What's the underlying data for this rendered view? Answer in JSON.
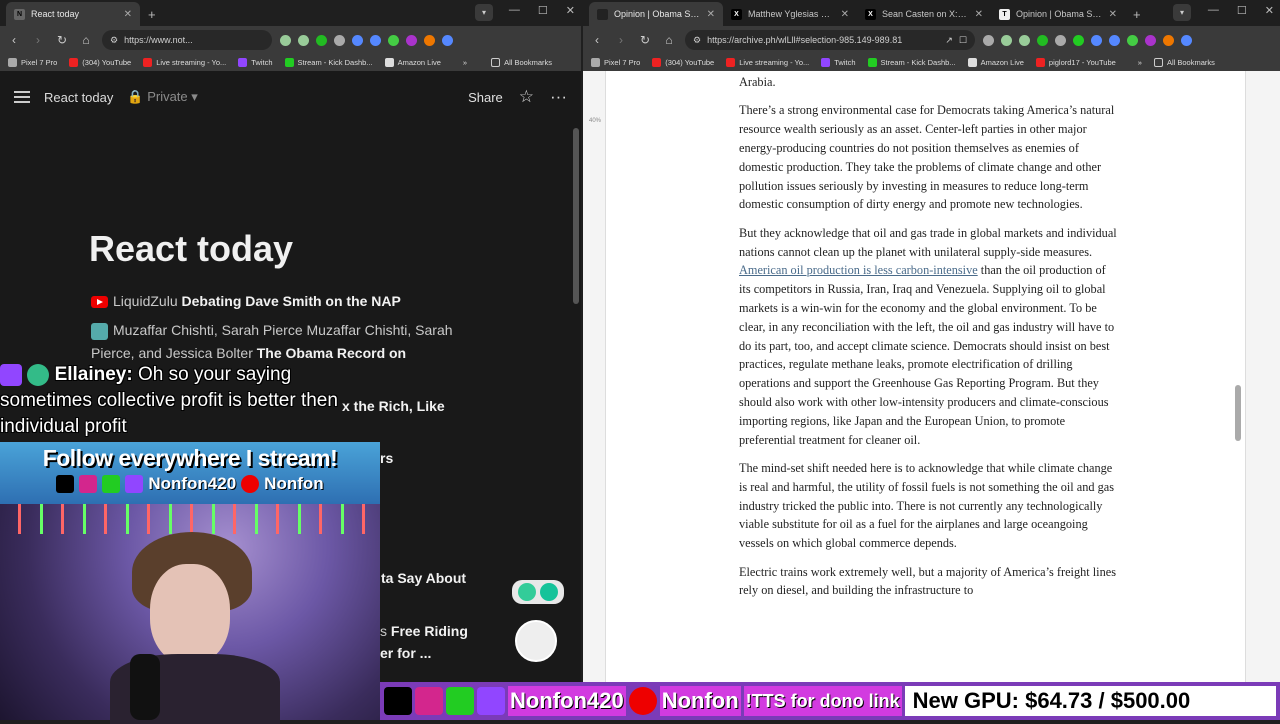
{
  "left_window": {
    "tabs": [
      {
        "label": "React today",
        "active": true
      }
    ],
    "url": "https://www.not...",
    "bookmarks": [
      "Pixel 7 Pro",
      "(304) YouTube",
      "Live streaming - Yo...",
      "Twitch",
      "Stream - Kick Dashb...",
      "Amazon Live"
    ],
    "all_bookmarks": "All Bookmarks",
    "page": {
      "breadcrumb": "React today",
      "privacy": "Private",
      "share": "Share",
      "title": "React today",
      "items": [
        {
          "prefix": "LiquidZulu",
          "title": "Debating Dave Smith on the NAP"
        },
        {
          "prefix": "Muzaffar Chishti, Sarah Pierce Muzaffar Chishti, Sarah Pierce, and Jessica Bolter",
          "title": "The Obama Record on"
        },
        {
          "prefix": "",
          "title": "x the Rich, Like"
        },
        {
          "prefix": "",
          "title": "rs"
        },
        {
          "prefix": "",
          "title": "ta Say About"
        },
        {
          "prefix": "s",
          "title": "Free Riding"
        },
        {
          "prefix": "",
          "title": "er for ..."
        }
      ]
    }
  },
  "stream_overlay": {
    "chat_user": "Ellainey:",
    "chat_message": "Oh so your saying sometimes collective profit is better then individual profit",
    "follow_title": "Follow everywhere I stream!",
    "handle": "Nonfon420",
    "yt_handle": "Nonfon",
    "tts": "!TTS for dono link",
    "gpu": "New GPU: $64.73 / $500.00"
  },
  "right_window": {
    "tabs": [
      {
        "label": "Opinion | Obama Support",
        "active": true
      },
      {
        "label": "Matthew Yglesias on X: \"O",
        "active": false
      },
      {
        "label": "Sean Casten on X: \"This Y",
        "active": false
      },
      {
        "label": "Opinion | Obama Support",
        "active": false
      }
    ],
    "url": "https://archive.ph/wlLll#selection-985.149-989.81",
    "bookmarks": [
      "Pixel 7 Pro",
      "(304) YouTube",
      "Live streaming - Yo...",
      "Twitch",
      "Stream - Kick Dashb...",
      "Amazon Live",
      "piglord17 - YouTube"
    ],
    "all_bookmarks": "All Bookmarks",
    "percent": "40%",
    "article": {
      "p0": "Arabia.",
      "p1": "There’s a strong environmental case for Democrats taking America’s natural resource wealth seriously as an asset. Center-left parties in other major energy-producing countries do not position themselves as enemies of domestic production. They take the problems of climate change and other pollution issues seriously by investing in measures to reduce long-term domestic consumption of dirty energy and promote new technologies.",
      "p2a": "But they acknowledge that oil and gas trade in global markets and individual nations cannot clean up the planet with unilateral supply-side measures. ",
      "p2link": "American oil production is less carbon-intensive",
      "p2b": " than the oil production of its competitors in Russia, Iran, Iraq and Venezuela. Supplying oil to global markets is a win-win for the economy and the global environment. To be clear, in any reconciliation with the left, the oil and gas industry will have to do its part, too, and accept climate science. Democrats should insist on best practices, regulate methane leaks, promote electrification of drilling operations and support the Greenhouse Gas Reporting Program. But they should also work with other low-intensity producers and climate-conscious importing regions, like Japan and the European Union, to promote preferential treatment for cleaner oil.",
      "p3": "The mind-set shift needed here is to acknowledge that while climate change is real and harmful, the utility of fossil fuels is not something the oil and gas industry tricked the public into. There is not currently any technologically viable substitute for oil as a fuel for the airplanes and large oceangoing vessels on which global commerce depends.",
      "p4": "Electric trains work extremely well, but a majority of America’s freight lines rely on diesel, and building the infrastructure to"
    }
  }
}
